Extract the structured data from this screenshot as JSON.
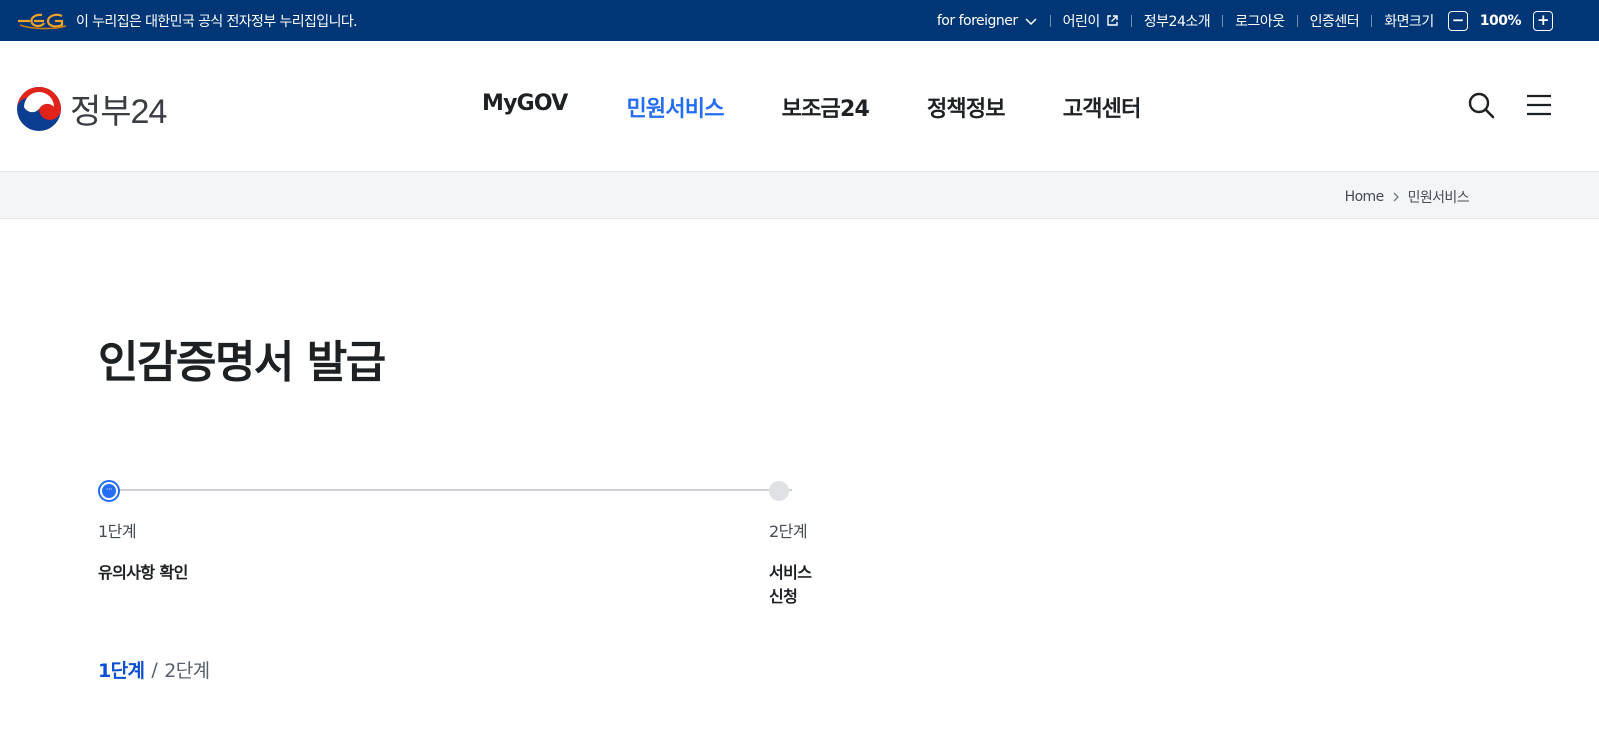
{
  "gov_bar": {
    "notice": "이 누리집은 대한민국 공식 전자정부 누리집입니다.",
    "links": {
      "foreigner": "for foreigner",
      "kids": "어린이",
      "about": "정부24소개",
      "logout": "로그아웃",
      "cert": "인증센터",
      "screen_size": "화면크기"
    },
    "zoom_minus": "−",
    "zoom_value": "100%",
    "zoom_plus": "+"
  },
  "header": {
    "brand": "정부24",
    "nav": [
      {
        "label": "MyGOV"
      },
      {
        "label": "민원서비스"
      },
      {
        "label": "보조금24"
      },
      {
        "label": "정책정보"
      },
      {
        "label": "고객센터"
      }
    ],
    "icons": {
      "search": "search-icon",
      "menu": "hamburger-menu-icon"
    }
  },
  "breadcrumb": {
    "home": "Home",
    "current": "민원서비스"
  },
  "page": {
    "title": "인감증명서 발급"
  },
  "stepper": {
    "current_dot_text": "···",
    "steps": [
      {
        "number": "1단계",
        "label": "유의사항 확인"
      },
      {
        "number": "2단계",
        "label": "서비스 신청"
      }
    ]
  },
  "step_indicator": {
    "current": "1단계",
    "separator": "/",
    "total": "2단계"
  },
  "colors": {
    "gov_bar_bg": "#003675",
    "accent": "#256ef4",
    "step_indicator": "#0b50d0"
  }
}
